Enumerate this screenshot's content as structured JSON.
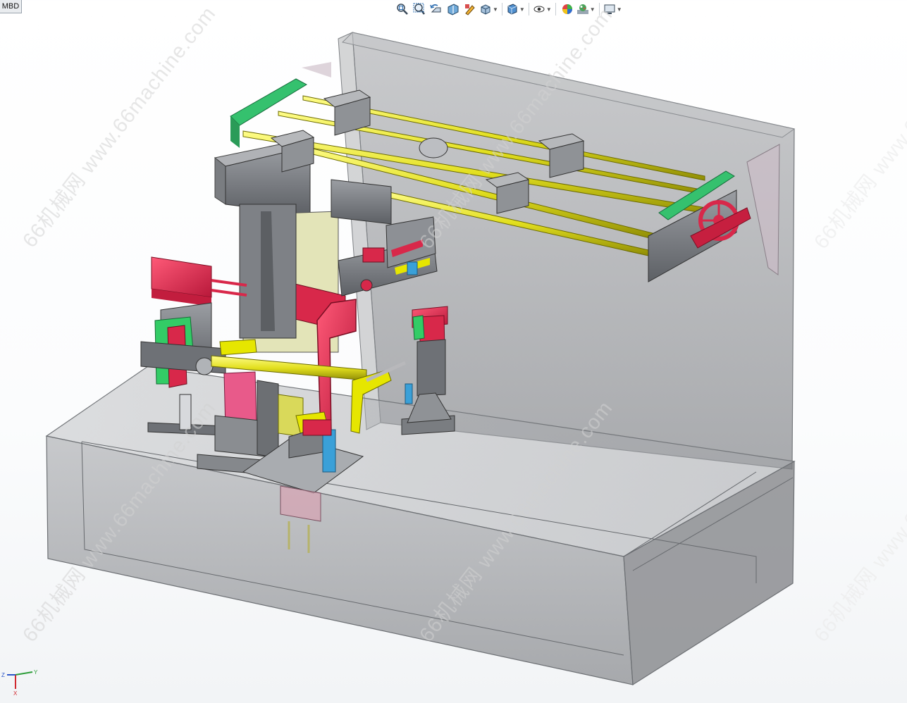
{
  "tab": {
    "label": "MBD"
  },
  "heads_up_toolbar": [
    {
      "name": "zoom-to-fit-icon",
      "has_dropdown": false
    },
    {
      "name": "zoom-to-area-icon",
      "has_dropdown": false
    },
    {
      "name": "previous-view-icon",
      "has_dropdown": false
    },
    {
      "name": "section-view-icon",
      "has_dropdown": false
    },
    {
      "name": "dynamic-annotation-icon",
      "has_dropdown": false
    },
    {
      "name": "view-orientation-icon",
      "has_dropdown": true
    },
    {
      "name": "display-style-icon",
      "has_dropdown": true
    },
    {
      "name": "hide-show-items-icon",
      "has_dropdown": true
    },
    {
      "name": "edit-appearance-icon",
      "has_dropdown": false
    },
    {
      "name": "apply-scene-icon",
      "has_dropdown": true
    },
    {
      "name": "view-settings-icon",
      "has_dropdown": true
    }
  ],
  "watermark": {
    "text": "66机械网 www.66machine.com"
  },
  "triad": {
    "x": "X",
    "y": "Y",
    "z": "Z"
  },
  "colors": {
    "frame": "#8a8d91",
    "rail": "#e6e600",
    "red_part": "#d8284a",
    "green_part": "#33cc66",
    "cream_part": "#e3e4b8",
    "blue_part": "#3aa0d8",
    "steel": "#6f7378"
  }
}
